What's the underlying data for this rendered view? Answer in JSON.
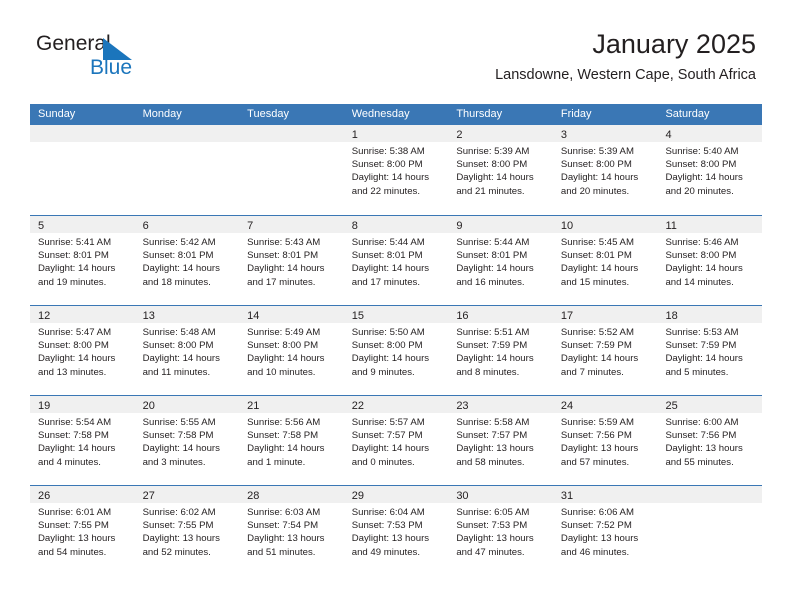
{
  "brand": {
    "line1": "General",
    "line2": "Blue",
    "mark": "triangle-logo"
  },
  "header": {
    "title": "January 2025",
    "subtitle": "Lansdowne, Western Cape, South Africa"
  },
  "colors": {
    "header_blue": "#3a77b5",
    "brand_blue": "#1b75bc",
    "daynum_band": "#f0f0f0",
    "text": "#231f20"
  },
  "weekdays": [
    "Sunday",
    "Monday",
    "Tuesday",
    "Wednesday",
    "Thursday",
    "Friday",
    "Saturday"
  ],
  "weeks": [
    [
      {
        "day": "",
        "lines": []
      },
      {
        "day": "",
        "lines": []
      },
      {
        "day": "",
        "lines": []
      },
      {
        "day": "1",
        "lines": [
          "Sunrise: 5:38 AM",
          "Sunset: 8:00 PM",
          "Daylight: 14 hours",
          "and 22 minutes."
        ]
      },
      {
        "day": "2",
        "lines": [
          "Sunrise: 5:39 AM",
          "Sunset: 8:00 PM",
          "Daylight: 14 hours",
          "and 21 minutes."
        ]
      },
      {
        "day": "3",
        "lines": [
          "Sunrise: 5:39 AM",
          "Sunset: 8:00 PM",
          "Daylight: 14 hours",
          "and 20 minutes."
        ]
      },
      {
        "day": "4",
        "lines": [
          "Sunrise: 5:40 AM",
          "Sunset: 8:00 PM",
          "Daylight: 14 hours",
          "and 20 minutes."
        ]
      }
    ],
    [
      {
        "day": "5",
        "lines": [
          "Sunrise: 5:41 AM",
          "Sunset: 8:01 PM",
          "Daylight: 14 hours",
          "and 19 minutes."
        ]
      },
      {
        "day": "6",
        "lines": [
          "Sunrise: 5:42 AM",
          "Sunset: 8:01 PM",
          "Daylight: 14 hours",
          "and 18 minutes."
        ]
      },
      {
        "day": "7",
        "lines": [
          "Sunrise: 5:43 AM",
          "Sunset: 8:01 PM",
          "Daylight: 14 hours",
          "and 17 minutes."
        ]
      },
      {
        "day": "8",
        "lines": [
          "Sunrise: 5:44 AM",
          "Sunset: 8:01 PM",
          "Daylight: 14 hours",
          "and 17 minutes."
        ]
      },
      {
        "day": "9",
        "lines": [
          "Sunrise: 5:44 AM",
          "Sunset: 8:01 PM",
          "Daylight: 14 hours",
          "and 16 minutes."
        ]
      },
      {
        "day": "10",
        "lines": [
          "Sunrise: 5:45 AM",
          "Sunset: 8:01 PM",
          "Daylight: 14 hours",
          "and 15 minutes."
        ]
      },
      {
        "day": "11",
        "lines": [
          "Sunrise: 5:46 AM",
          "Sunset: 8:00 PM",
          "Daylight: 14 hours",
          "and 14 minutes."
        ]
      }
    ],
    [
      {
        "day": "12",
        "lines": [
          "Sunrise: 5:47 AM",
          "Sunset: 8:00 PM",
          "Daylight: 14 hours",
          "and 13 minutes."
        ]
      },
      {
        "day": "13",
        "lines": [
          "Sunrise: 5:48 AM",
          "Sunset: 8:00 PM",
          "Daylight: 14 hours",
          "and 11 minutes."
        ]
      },
      {
        "day": "14",
        "lines": [
          "Sunrise: 5:49 AM",
          "Sunset: 8:00 PM",
          "Daylight: 14 hours",
          "and 10 minutes."
        ]
      },
      {
        "day": "15",
        "lines": [
          "Sunrise: 5:50 AM",
          "Sunset: 8:00 PM",
          "Daylight: 14 hours",
          "and 9 minutes."
        ]
      },
      {
        "day": "16",
        "lines": [
          "Sunrise: 5:51 AM",
          "Sunset: 7:59 PM",
          "Daylight: 14 hours",
          "and 8 minutes."
        ]
      },
      {
        "day": "17",
        "lines": [
          "Sunrise: 5:52 AM",
          "Sunset: 7:59 PM",
          "Daylight: 14 hours",
          "and 7 minutes."
        ]
      },
      {
        "day": "18",
        "lines": [
          "Sunrise: 5:53 AM",
          "Sunset: 7:59 PM",
          "Daylight: 14 hours",
          "and 5 minutes."
        ]
      }
    ],
    [
      {
        "day": "19",
        "lines": [
          "Sunrise: 5:54 AM",
          "Sunset: 7:58 PM",
          "Daylight: 14 hours",
          "and 4 minutes."
        ]
      },
      {
        "day": "20",
        "lines": [
          "Sunrise: 5:55 AM",
          "Sunset: 7:58 PM",
          "Daylight: 14 hours",
          "and 3 minutes."
        ]
      },
      {
        "day": "21",
        "lines": [
          "Sunrise: 5:56 AM",
          "Sunset: 7:58 PM",
          "Daylight: 14 hours",
          "and 1 minute."
        ]
      },
      {
        "day": "22",
        "lines": [
          "Sunrise: 5:57 AM",
          "Sunset: 7:57 PM",
          "Daylight: 14 hours",
          "and 0 minutes."
        ]
      },
      {
        "day": "23",
        "lines": [
          "Sunrise: 5:58 AM",
          "Sunset: 7:57 PM",
          "Daylight: 13 hours",
          "and 58 minutes."
        ]
      },
      {
        "day": "24",
        "lines": [
          "Sunrise: 5:59 AM",
          "Sunset: 7:56 PM",
          "Daylight: 13 hours",
          "and 57 minutes."
        ]
      },
      {
        "day": "25",
        "lines": [
          "Sunrise: 6:00 AM",
          "Sunset: 7:56 PM",
          "Daylight: 13 hours",
          "and 55 minutes."
        ]
      }
    ],
    [
      {
        "day": "26",
        "lines": [
          "Sunrise: 6:01 AM",
          "Sunset: 7:55 PM",
          "Daylight: 13 hours",
          "and 54 minutes."
        ]
      },
      {
        "day": "27",
        "lines": [
          "Sunrise: 6:02 AM",
          "Sunset: 7:55 PM",
          "Daylight: 13 hours",
          "and 52 minutes."
        ]
      },
      {
        "day": "28",
        "lines": [
          "Sunrise: 6:03 AM",
          "Sunset: 7:54 PM",
          "Daylight: 13 hours",
          "and 51 minutes."
        ]
      },
      {
        "day": "29",
        "lines": [
          "Sunrise: 6:04 AM",
          "Sunset: 7:53 PM",
          "Daylight: 13 hours",
          "and 49 minutes."
        ]
      },
      {
        "day": "30",
        "lines": [
          "Sunrise: 6:05 AM",
          "Sunset: 7:53 PM",
          "Daylight: 13 hours",
          "and 47 minutes."
        ]
      },
      {
        "day": "31",
        "lines": [
          "Sunrise: 6:06 AM",
          "Sunset: 7:52 PM",
          "Daylight: 13 hours",
          "and 46 minutes."
        ]
      },
      {
        "day": "",
        "lines": []
      }
    ]
  ]
}
